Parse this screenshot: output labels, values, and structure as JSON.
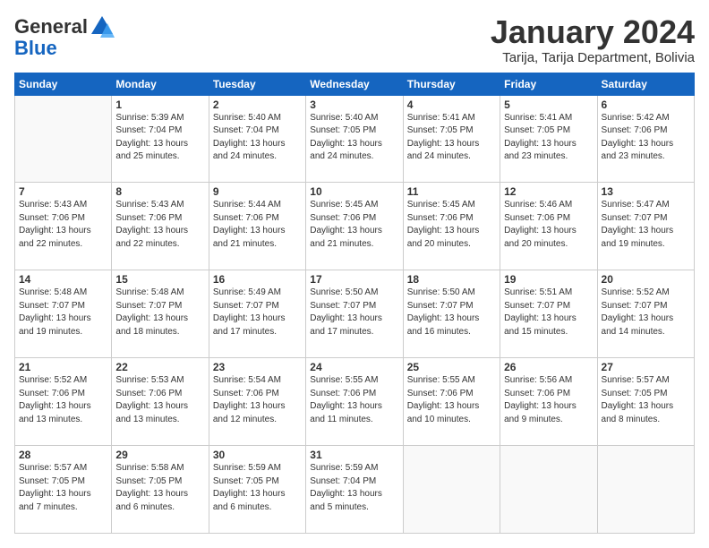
{
  "logo": {
    "general": "General",
    "blue": "Blue"
  },
  "title": "January 2024",
  "location": "Tarija, Tarija Department, Bolivia",
  "weekdays": [
    "Sunday",
    "Monday",
    "Tuesday",
    "Wednesday",
    "Thursday",
    "Friday",
    "Saturday"
  ],
  "weeks": [
    [
      {
        "day": "",
        "info": ""
      },
      {
        "day": "1",
        "info": "Sunrise: 5:39 AM\nSunset: 7:04 PM\nDaylight: 13 hours\nand 25 minutes."
      },
      {
        "day": "2",
        "info": "Sunrise: 5:40 AM\nSunset: 7:04 PM\nDaylight: 13 hours\nand 24 minutes."
      },
      {
        "day": "3",
        "info": "Sunrise: 5:40 AM\nSunset: 7:05 PM\nDaylight: 13 hours\nand 24 minutes."
      },
      {
        "day": "4",
        "info": "Sunrise: 5:41 AM\nSunset: 7:05 PM\nDaylight: 13 hours\nand 24 minutes."
      },
      {
        "day": "5",
        "info": "Sunrise: 5:41 AM\nSunset: 7:05 PM\nDaylight: 13 hours\nand 23 minutes."
      },
      {
        "day": "6",
        "info": "Sunrise: 5:42 AM\nSunset: 7:06 PM\nDaylight: 13 hours\nand 23 minutes."
      }
    ],
    [
      {
        "day": "7",
        "info": "Sunrise: 5:43 AM\nSunset: 7:06 PM\nDaylight: 13 hours\nand 22 minutes."
      },
      {
        "day": "8",
        "info": "Sunrise: 5:43 AM\nSunset: 7:06 PM\nDaylight: 13 hours\nand 22 minutes."
      },
      {
        "day": "9",
        "info": "Sunrise: 5:44 AM\nSunset: 7:06 PM\nDaylight: 13 hours\nand 21 minutes."
      },
      {
        "day": "10",
        "info": "Sunrise: 5:45 AM\nSunset: 7:06 PM\nDaylight: 13 hours\nand 21 minutes."
      },
      {
        "day": "11",
        "info": "Sunrise: 5:45 AM\nSunset: 7:06 PM\nDaylight: 13 hours\nand 20 minutes."
      },
      {
        "day": "12",
        "info": "Sunrise: 5:46 AM\nSunset: 7:06 PM\nDaylight: 13 hours\nand 20 minutes."
      },
      {
        "day": "13",
        "info": "Sunrise: 5:47 AM\nSunset: 7:07 PM\nDaylight: 13 hours\nand 19 minutes."
      }
    ],
    [
      {
        "day": "14",
        "info": "Sunrise: 5:48 AM\nSunset: 7:07 PM\nDaylight: 13 hours\nand 19 minutes."
      },
      {
        "day": "15",
        "info": "Sunrise: 5:48 AM\nSunset: 7:07 PM\nDaylight: 13 hours\nand 18 minutes."
      },
      {
        "day": "16",
        "info": "Sunrise: 5:49 AM\nSunset: 7:07 PM\nDaylight: 13 hours\nand 17 minutes."
      },
      {
        "day": "17",
        "info": "Sunrise: 5:50 AM\nSunset: 7:07 PM\nDaylight: 13 hours\nand 17 minutes."
      },
      {
        "day": "18",
        "info": "Sunrise: 5:50 AM\nSunset: 7:07 PM\nDaylight: 13 hours\nand 16 minutes."
      },
      {
        "day": "19",
        "info": "Sunrise: 5:51 AM\nSunset: 7:07 PM\nDaylight: 13 hours\nand 15 minutes."
      },
      {
        "day": "20",
        "info": "Sunrise: 5:52 AM\nSunset: 7:07 PM\nDaylight: 13 hours\nand 14 minutes."
      }
    ],
    [
      {
        "day": "21",
        "info": "Sunrise: 5:52 AM\nSunset: 7:06 PM\nDaylight: 13 hours\nand 13 minutes."
      },
      {
        "day": "22",
        "info": "Sunrise: 5:53 AM\nSunset: 7:06 PM\nDaylight: 13 hours\nand 13 minutes."
      },
      {
        "day": "23",
        "info": "Sunrise: 5:54 AM\nSunset: 7:06 PM\nDaylight: 13 hours\nand 12 minutes."
      },
      {
        "day": "24",
        "info": "Sunrise: 5:55 AM\nSunset: 7:06 PM\nDaylight: 13 hours\nand 11 minutes."
      },
      {
        "day": "25",
        "info": "Sunrise: 5:55 AM\nSunset: 7:06 PM\nDaylight: 13 hours\nand 10 minutes."
      },
      {
        "day": "26",
        "info": "Sunrise: 5:56 AM\nSunset: 7:06 PM\nDaylight: 13 hours\nand 9 minutes."
      },
      {
        "day": "27",
        "info": "Sunrise: 5:57 AM\nSunset: 7:05 PM\nDaylight: 13 hours\nand 8 minutes."
      }
    ],
    [
      {
        "day": "28",
        "info": "Sunrise: 5:57 AM\nSunset: 7:05 PM\nDaylight: 13 hours\nand 7 minutes."
      },
      {
        "day": "29",
        "info": "Sunrise: 5:58 AM\nSunset: 7:05 PM\nDaylight: 13 hours\nand 6 minutes."
      },
      {
        "day": "30",
        "info": "Sunrise: 5:59 AM\nSunset: 7:05 PM\nDaylight: 13 hours\nand 6 minutes."
      },
      {
        "day": "31",
        "info": "Sunrise: 5:59 AM\nSunset: 7:04 PM\nDaylight: 13 hours\nand 5 minutes."
      },
      {
        "day": "",
        "info": ""
      },
      {
        "day": "",
        "info": ""
      },
      {
        "day": "",
        "info": ""
      }
    ]
  ]
}
